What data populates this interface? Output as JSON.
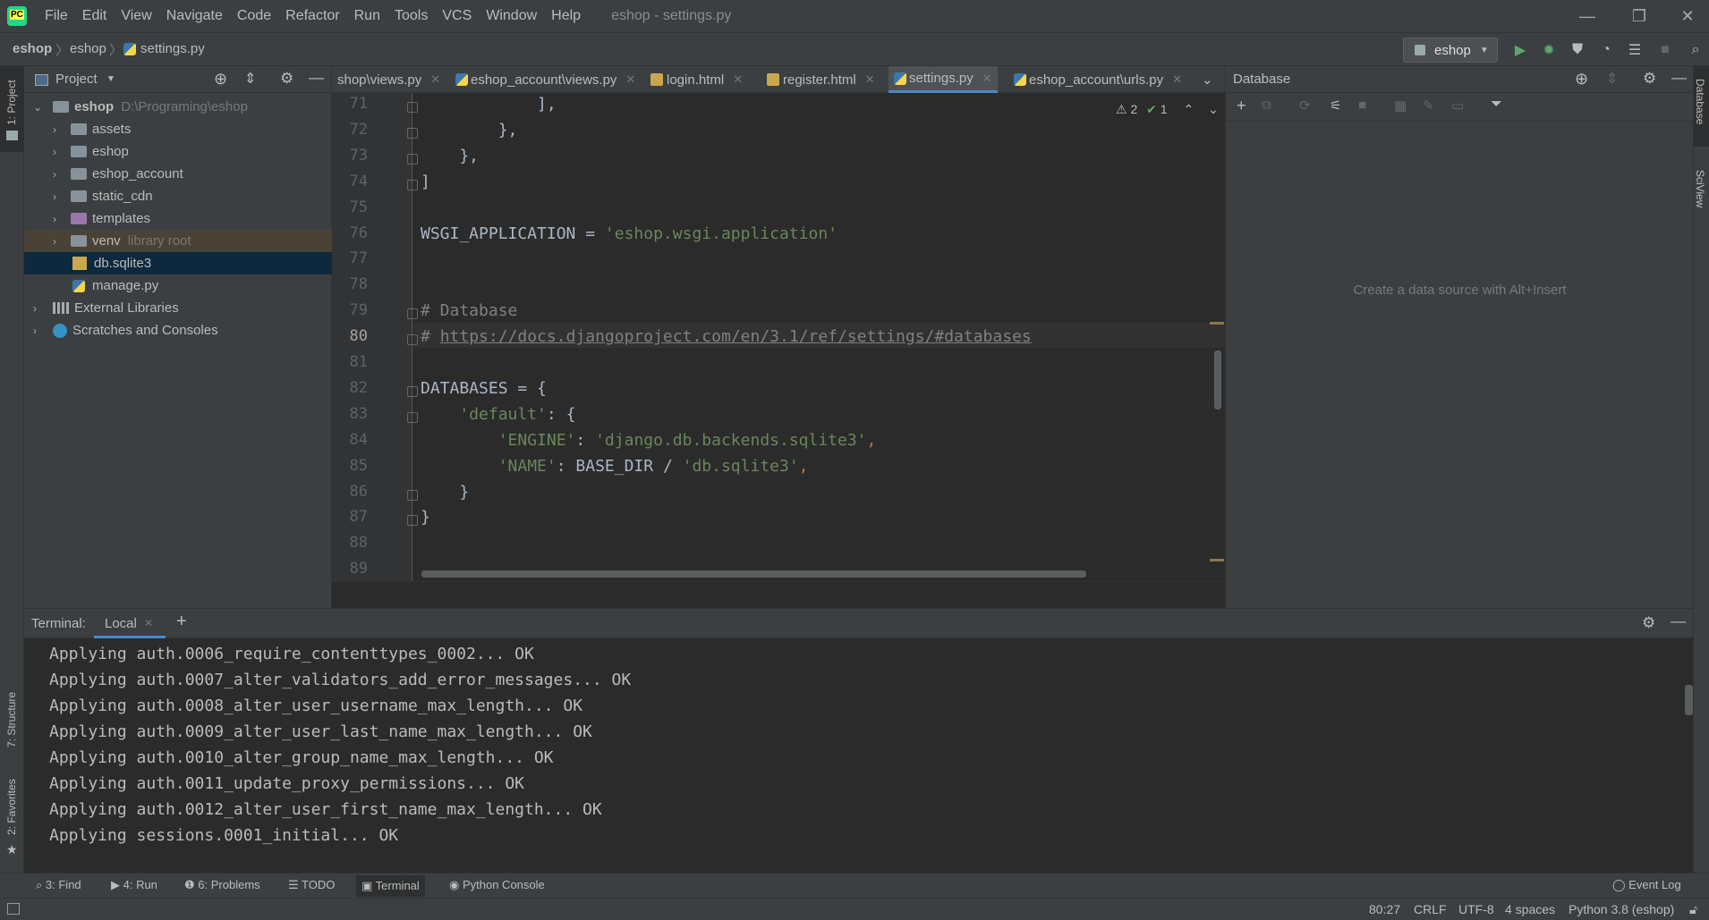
{
  "window": {
    "title": "eshop - settings.py",
    "menu": [
      "File",
      "Edit",
      "View",
      "Navigate",
      "Code",
      "Refactor",
      "Run",
      "Tools",
      "VCS",
      "Window",
      "Help"
    ]
  },
  "navbar": {
    "crumbs": [
      "eshop",
      "eshop",
      "settings.py"
    ],
    "run_config": "eshop"
  },
  "left_strip": {
    "project": "1: Project",
    "structure": "7: Structure",
    "favorites": "2: Favorites"
  },
  "right_strip": {
    "database": "Database",
    "sciview": "SciView"
  },
  "project": {
    "title": "Project",
    "root_name": "eshop",
    "root_path": "D:\\Programing\\eshop",
    "items": [
      {
        "label": "assets"
      },
      {
        "label": "eshop"
      },
      {
        "label": "eshop_account"
      },
      {
        "label": "static_cdn"
      },
      {
        "label": "templates"
      },
      {
        "label": "venv",
        "hint": "library root"
      },
      {
        "label": "db.sqlite3"
      },
      {
        "label": "manage.py"
      },
      {
        "label": "External Libraries"
      },
      {
        "label": "Scratches and Consoles"
      }
    ]
  },
  "tabs": [
    {
      "label": "shop\\views.py"
    },
    {
      "label": "eshop_account\\views.py"
    },
    {
      "label": "login.html"
    },
    {
      "label": "register.html"
    },
    {
      "label": "settings.py"
    },
    {
      "label": "eshop_account\\urls.py"
    }
  ],
  "editor": {
    "warnings": "2",
    "checks": "1",
    "current_line": "80",
    "lines": [
      {
        "n": "71",
        "t": "            ],"
      },
      {
        "n": "72",
        "t": "        },"
      },
      {
        "n": "73",
        "t": "    },"
      },
      {
        "n": "74",
        "t": "]"
      },
      {
        "n": "75",
        "t": ""
      },
      {
        "n": "76",
        "a": "WSGI_APPLICATION = ",
        "s": "'eshop.wsgi.application'"
      },
      {
        "n": "77",
        "t": ""
      },
      {
        "n": "78",
        "t": ""
      },
      {
        "n": "79",
        "c": "# Database"
      },
      {
        "n": "80",
        "c": "# ",
        "link": "https://docs.djangoproject.com/en/3.1/ref/settings/#databases"
      },
      {
        "n": "81",
        "t": ""
      },
      {
        "n": "82",
        "t": "DATABASES = {"
      },
      {
        "n": "83",
        "a": "    ",
        "s": "'default'",
        "b": ": {"
      },
      {
        "n": "84",
        "a": "        ",
        "s": "'ENGINE'",
        "b": ": ",
        "s2": "'django.db.backends.sqlite3'",
        "e": ","
      },
      {
        "n": "85",
        "a": "        ",
        "s": "'NAME'",
        "b": ": BASE_DIR / ",
        "s2": "'db.sqlite3'",
        "e": ","
      },
      {
        "n": "86",
        "t": "    }"
      },
      {
        "n": "87",
        "t": "}"
      },
      {
        "n": "88",
        "t": ""
      },
      {
        "n": "89",
        "t": ""
      }
    ]
  },
  "database": {
    "title": "Database",
    "empty_hint": "Create a data source with Alt+Insert"
  },
  "terminal": {
    "label": "Terminal:",
    "tab": "Local",
    "lines": [
      "Applying auth.0006_require_contenttypes_0002... OK",
      "Applying auth.0007_alter_validators_add_error_messages... OK",
      "Applying auth.0008_alter_user_username_max_length... OK",
      "Applying auth.0009_alter_user_last_name_max_length... OK",
      "Applying auth.0010_alter_group_name_max_length... OK",
      "Applying auth.0011_update_proxy_permissions... OK",
      "Applying auth.0012_alter_user_first_name_max_length... OK",
      "Applying sessions.0001_initial... OK"
    ]
  },
  "bottom_tools": {
    "find": "3: Find",
    "run": "4: Run",
    "problems": "6: Problems",
    "todo": "TODO",
    "terminal": "Terminal",
    "python_console": "Python Console",
    "event_log": "Event Log"
  },
  "status": {
    "position": "80:27",
    "line_sep": "CRLF",
    "encoding": "UTF-8",
    "indent": "4 spaces",
    "interpreter": "Python 3.8 (eshop)"
  },
  "colors": {
    "accent": "#4a88c7",
    "string": "#6a8759",
    "comment": "#808080",
    "run_green": "#59a869"
  }
}
